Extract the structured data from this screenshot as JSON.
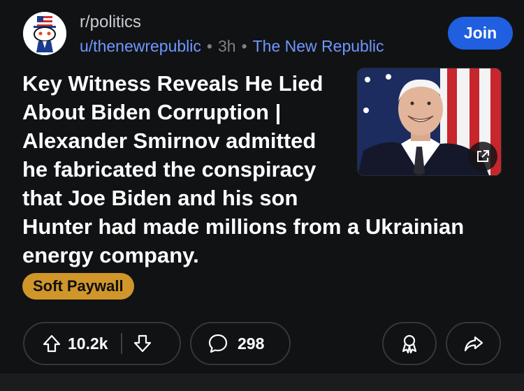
{
  "post": {
    "subreddit": "r/politics",
    "user": "u/thenewrepublic",
    "time": "3h",
    "source": "The New Republic",
    "join_label": "Join",
    "title_lines": [
      "Key Witness Reveals He Lied",
      "About Biden Corruption |",
      "Alexander Smirnov admitted",
      "he fabricated the conspiracy",
      "that Joe Biden and his son",
      "Hunter had made millions from a Ukrainian",
      "energy company."
    ],
    "flair": "Soft Paywall",
    "upvotes": "10.2k",
    "comments": "298"
  },
  "colors": {
    "background": "#111214",
    "accent_blue": "#1f5fe0",
    "link_blue": "#6f97ff",
    "flair": "#d0962a"
  },
  "icons": [
    "subreddit-avatar-icon",
    "external-link-icon",
    "upvote-icon",
    "downvote-icon",
    "comment-icon",
    "award-icon",
    "share-icon"
  ]
}
